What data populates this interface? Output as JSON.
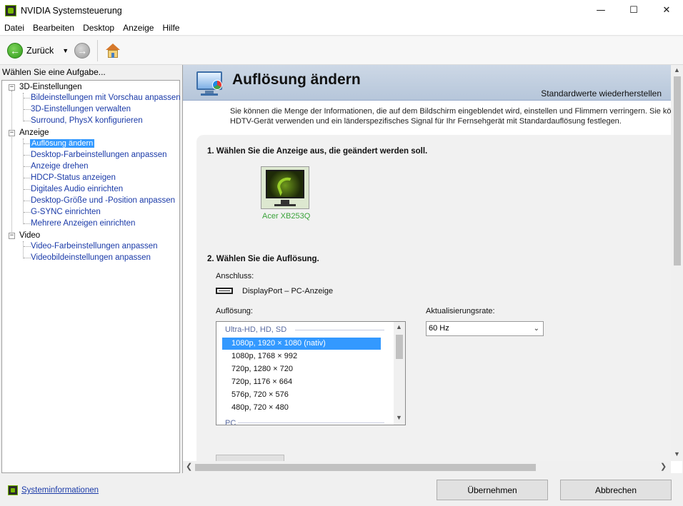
{
  "window": {
    "title": "NVIDIA Systemsteuerung",
    "controls": {
      "minimize": "—",
      "maximize": "☐",
      "close": "✕"
    }
  },
  "menu": [
    "Datei",
    "Bearbeiten",
    "Desktop",
    "Anzeige",
    "Hilfe"
  ],
  "toolbar": {
    "back_label": "Zurück",
    "icons": {
      "back": "back-arrow-icon",
      "dropdown": "chevron-down-icon",
      "forward": "forward-arrow-icon",
      "home": "home-icon"
    }
  },
  "sidebar": {
    "task_label": "Wählen Sie eine Aufgabe...",
    "categories": [
      {
        "label": "3D-Einstellungen",
        "items": [
          "Bildeinstellungen mit Vorschau anpassen",
          "3D-Einstellungen verwalten",
          "Surround, PhysX konfigurieren"
        ]
      },
      {
        "label": "Anzeige",
        "items": [
          "Auflösung ändern",
          "Desktop-Farbeinstellungen anpassen",
          "Anzeige drehen",
          "HDCP-Status anzeigen",
          "Digitales Audio einrichten",
          "Desktop-Größe und -Position anpassen",
          "G-SYNC einrichten",
          "Mehrere Anzeigen einrichten"
        ]
      },
      {
        "label": "Video",
        "items": [
          "Video-Farbeinstellungen anpassen",
          "Videobildeinstellungen anpassen"
        ]
      }
    ],
    "selected": "Auflösung ändern"
  },
  "page": {
    "title": "Auflösung ändern",
    "restore_defaults": "Standardwerte wiederherstellen",
    "intro_line1": "Sie können die Menge der Informationen, die auf dem Bildschirm eingeblendet wird, einstellen und Flimmern verringern. Sie können",
    "intro_line2": "HDTV-Gerät verwenden und ein länderspezifisches Signal für Ihr Fernsehgerät mit Standardauflösung festlegen.",
    "section1_heading": "1. Wählen Sie die Anzeige aus, die geändert werden soll.",
    "display_name": "Acer XB253Q",
    "section2_heading": "2. Wählen Sie die Auflösung.",
    "connection_label": "Anschluss:",
    "connection_value": "DisplayPort – PC-Anzeige",
    "resolution_label": "Auflösung:",
    "refresh_label": "Aktualisierungsrate:",
    "refresh_value": "60 Hz",
    "resolution_groups": [
      "Ultra-HD, HD, SD",
      "PC"
    ],
    "resolutions": [
      "1080p, 1920 × 1080 (nativ)",
      "1080p, 1768 × 992",
      "720p, 1280 × 720",
      "720p, 1176 × 664",
      "576p, 720 × 576",
      "480p, 720 × 480"
    ],
    "selected_resolution": "1080p, 1920 × 1080 (nativ)"
  },
  "footer": {
    "system_info": "Systeminformationen",
    "apply": "Übernehmen",
    "cancel": "Abbrechen"
  },
  "colors": {
    "accent_selection": "#3399ff",
    "link": "#1a3aa8",
    "nvidia_green": "#76b900",
    "header_band": "#b6c6da"
  }
}
